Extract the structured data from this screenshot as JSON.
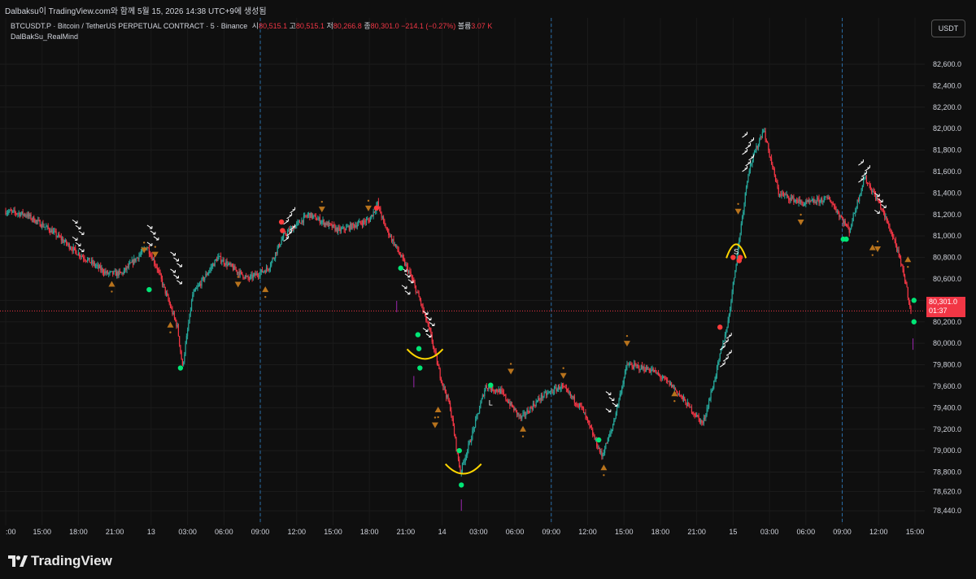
{
  "header": {
    "caption": "Dalbaksu이 TradingView.com와 함께 5월 15, 2026 14:38 UTC+9에 생성됨"
  },
  "legend": {
    "symbol": "BTCUSDT.P · Bitcoin / TetherUS PERPETUAL CONTRACT · 5 · Binance",
    "open_label": "시",
    "open": "80,515.1",
    "high_label": "고",
    "high": "80,515.1",
    "low_label": "저",
    "low": "80,266.8",
    "close_label": "종",
    "close": "80,301.0",
    "change": "−214.1 (−0.27%)",
    "volume_label": "볼륨",
    "volume": "3.07 K",
    "indicator": "DalBakSu_RealMind"
  },
  "currency_button": "USDT",
  "current_price": {
    "value": "80,301.0",
    "countdown": "01:37"
  },
  "brand": "TradingView",
  "colors": {
    "up": "#26a69a",
    "down": "#f23645",
    "signal_green": "#00e676",
    "signal_red": "#ff3b3b",
    "triangle": "#b8731c",
    "arc": "#ffd600",
    "vline": "#2a6ea8"
  },
  "chart_data": {
    "type": "candlestick",
    "title": "",
    "xlabel": "",
    "ylabel": "",
    "ylim": [
      78380,
      82880
    ],
    "yticks": [
      78440,
      78620,
      78800,
      79000,
      79200,
      79400,
      79600,
      79800,
      80000,
      80200,
      80400,
      80600,
      80800,
      81000,
      81200,
      81400,
      81600,
      81800,
      82000,
      82200,
      82400,
      82600
    ],
    "ytick_labels": [
      "78,440.0",
      "78,620.0",
      "78,800.0",
      "79,000.0",
      "79,200.0",
      "79,400.0",
      "79,600.0",
      "79,800.0",
      "80,000.0",
      "80,200.0",
      "80,400.0",
      "80,600.0",
      "80,800.0",
      "81,000.0",
      "81,200.0",
      "81,400.0",
      "81,600.0",
      "81,800.0",
      "82,000.0",
      "82,200.0",
      "82,400.0",
      "82,600.0"
    ],
    "x_start": "13 12:00",
    "x_step_minutes": 5,
    "xticks": [
      {
        "label": ":00",
        "bar": 0
      },
      {
        "label": "15:00",
        "bar": 36
      },
      {
        "label": "18:00",
        "bar": 72
      },
      {
        "label": "21:00",
        "bar": 108
      },
      {
        "label": "13",
        "bar": 144
      },
      {
        "label": "03:00",
        "bar": 180
      },
      {
        "label": "06:00",
        "bar": 216
      },
      {
        "label": "09:00",
        "bar": 252
      },
      {
        "label": "12:00",
        "bar": 288
      },
      {
        "label": "15:00",
        "bar": 324
      },
      {
        "label": "18:00",
        "bar": 360
      },
      {
        "label": "21:00",
        "bar": 396
      },
      {
        "label": "14",
        "bar": 432
      },
      {
        "label": "03:00",
        "bar": 468
      },
      {
        "label": "06:00",
        "bar": 504
      },
      {
        "label": "09:00",
        "bar": 540
      },
      {
        "label": "12:00",
        "bar": 576
      },
      {
        "label": "15:00",
        "bar": 612
      },
      {
        "label": "18:00",
        "bar": 648
      },
      {
        "label": "21:00",
        "bar": 684
      },
      {
        "label": "15",
        "bar": 720
      },
      {
        "label": "03:00",
        "bar": 756
      },
      {
        "label": "06:00",
        "bar": 792
      },
      {
        "label": "09:00",
        "bar": 828
      },
      {
        "label": "12:00",
        "bar": 864
      },
      {
        "label": "15:00",
        "bar": 900
      }
    ],
    "session_lines_bar": [
      252,
      540,
      828
    ],
    "close_path_anchors": [
      [
        0,
        81230
      ],
      [
        20,
        81200
      ],
      [
        45,
        81050
      ],
      [
        70,
        80850
      ],
      [
        100,
        80650
      ],
      [
        115,
        80650
      ],
      [
        140,
        80900
      ],
      [
        150,
        80700
      ],
      [
        170,
        80150
      ],
      [
        175,
        79780
      ],
      [
        185,
        80450
      ],
      [
        210,
        80800
      ],
      [
        240,
        80600
      ],
      [
        260,
        80700
      ],
      [
        275,
        81000
      ],
      [
        300,
        81200
      ],
      [
        330,
        81050
      ],
      [
        360,
        81150
      ],
      [
        368,
        81300
      ],
      [
        375,
        81100
      ],
      [
        400,
        80650
      ],
      [
        410,
        80400
      ],
      [
        420,
        80100
      ],
      [
        430,
        79700
      ],
      [
        440,
        79400
      ],
      [
        450,
        78800
      ],
      [
        460,
        79100
      ],
      [
        475,
        79600
      ],
      [
        490,
        79550
      ],
      [
        510,
        79300
      ],
      [
        530,
        79500
      ],
      [
        550,
        79600
      ],
      [
        570,
        79400
      ],
      [
        590,
        78950
      ],
      [
        600,
        79200
      ],
      [
        615,
        79800
      ],
      [
        640,
        79750
      ],
      [
        660,
        79600
      ],
      [
        690,
        79250
      ],
      [
        700,
        79600
      ],
      [
        715,
        80200
      ],
      [
        735,
        81600
      ],
      [
        750,
        82000
      ],
      [
        765,
        81400
      ],
      [
        790,
        81300
      ],
      [
        815,
        81350
      ],
      [
        835,
        81050
      ],
      [
        850,
        81550
      ],
      [
        865,
        81300
      ],
      [
        880,
        80950
      ],
      [
        890,
        80600
      ],
      [
        896,
        80301
      ]
    ],
    "last_close": 80301.0,
    "signals": {
      "green_dots": [
        [
          142,
          80500
        ],
        [
          173,
          79770
        ],
        [
          391,
          80700
        ],
        [
          408,
          80080
        ],
        [
          409,
          79950
        ],
        [
          410,
          79770
        ],
        [
          449,
          79000
        ],
        [
          451,
          78680
        ],
        [
          480,
          79610
        ],
        [
          587,
          79100
        ],
        [
          829,
          80970
        ],
        [
          832,
          80970
        ],
        [
          899,
          80400
        ],
        [
          899,
          80200
        ]
      ],
      "red_dots": [
        [
          274,
          81050
        ],
        [
          273,
          81130
        ],
        [
          367,
          81260
        ],
        [
          707,
          80150
        ],
        [
          720,
          80800
        ],
        [
          726,
          80770
        ],
        [
          727,
          80800
        ]
      ],
      "triangles_up": [
        [
          105,
          80550
        ],
        [
          163,
          80170
        ],
        [
          257,
          80500
        ],
        [
          428,
          79380
        ],
        [
          512,
          79200
        ],
        [
          592,
          78840
        ],
        [
          662,
          79530
        ],
        [
          858,
          80890
        ],
        [
          893,
          80780
        ]
      ],
      "triangles_down": [
        [
          137,
          80870
        ],
        [
          148,
          80830
        ],
        [
          230,
          80550
        ],
        [
          313,
          81250
        ],
        [
          359,
          81260
        ],
        [
          425,
          79240
        ],
        [
          500,
          79740
        ],
        [
          552,
          79700
        ],
        [
          615,
          80000
        ],
        [
          725,
          81230
        ],
        [
          787,
          81130
        ],
        [
          863,
          80880
        ]
      ],
      "labels": [
        {
          "text": "L",
          "bar": 480,
          "price": 79420
        },
        {
          "text": "S",
          "bar": 723,
          "price": 80830
        }
      ]
    }
  }
}
